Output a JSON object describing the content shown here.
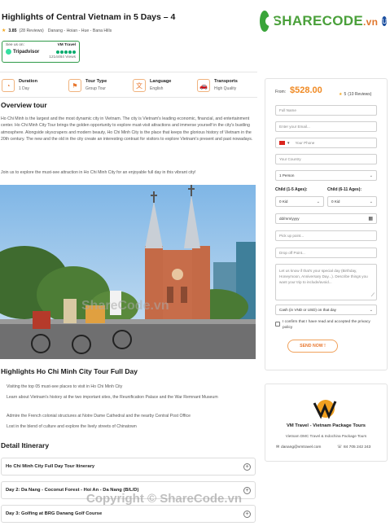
{
  "tour": {
    "title": "Highlights of Central Vietnam in 5 Days – 4",
    "rating_score": "3.85",
    "rating_count": "(28 Reviews)",
    "route": "Danang - Hoian - Hue - Bana Hills"
  },
  "brand": {
    "name": "SHARECODE",
    "suffix": ".vn",
    "badge": "U"
  },
  "tripadvisor": {
    "see_us_on": "See us on:",
    "agency": "VM Travel",
    "logo_text": "Tripadvisor",
    "views": "1214464 Views"
  },
  "facts": [
    {
      "label": "Duration",
      "value": "1 Day",
      "icon": "clock-icon"
    },
    {
      "label": "Tour Type",
      "value": "Group Tour",
      "icon": "flag-icon"
    },
    {
      "label": "Language",
      "value": "English",
      "icon": "translate-icon"
    },
    {
      "label": "Transports",
      "value": "High Quality",
      "icon": "car-icon"
    }
  ],
  "overview": {
    "heading": "Overview tour",
    "p1": "Ho Chi Minh is the largest and the most dynamic city in Vietnam. The city is Vietnam's leading economic, financial, and entertainment center. Ho Chi Minh City Tour brings the golden opportunity to explore must-visit attractions and immerse yourself in the city's bustling atmosphere. Alongside skyscrapers and modern beauty, Ho Chi Minh City is the place that keeps the glorious history of Vietnam in the 20th century. The new and the old in the city create an interesting contrast for visitors to explore Vietnam's present and past nowadays.",
    "p2": "Join us to explore the must-see attraction in Ho Chi Minh City for an enjoyable full day in this vibrant city!"
  },
  "watermark": {
    "image_text": "ShareCode.vn",
    "footer_text": "Copyright © ShareCode.vn"
  },
  "highlights": {
    "heading": "Highlights Ho Chi Minh City Tour Full Day",
    "items": [
      "Visiting the top 05 must-see places to visit in Ho Chi Minh City",
      "Learn about Vietnam's history at the two important sites, the Reunification Palace and the War Remnant Museum",
      "Admire the French colonial structures at Notre Dame Cathedral and the nearby Central Post Office",
      "Lost in the blend of culture and explore the lively streets of Chinatown"
    ]
  },
  "itinerary": {
    "heading": "Detail Itinerary",
    "days": [
      "Ho Chi Minh City Full Day Tour Itinerary",
      "Day 2: Da Nang - Coconut Forest - Hoi An - Da Nang (B/L/D)",
      "Day 3: Golfing at BRG Danang Golf Course"
    ]
  },
  "booking": {
    "from_label": "From:",
    "price": "$528.00",
    "rating": "5",
    "reviews": "(10 Reviews)",
    "full_name": "Full Name",
    "email": "Enter your Email...",
    "phone": "Your Phone",
    "country": "Your Country",
    "persons": "1 Person",
    "child_1_5_label": "Child (1-5 Ages):",
    "child_6_11_label": "Child (6-11 Ages):",
    "child_1_5": "0 Kid",
    "child_6_11": "0 Kid",
    "date": "dd/mm/yyyy",
    "pickup": "Pick up point...",
    "dropoff": "Drop off Point...",
    "message": "Let us know if that's your special day (Birthday, Honeymoon, Anniversary Day...). Describe things you want your trip to include/avoid...",
    "payment": "Cash (in VND or USD) on that day",
    "agree": "I confirm that I have read and accepted the privacy policy",
    "send": "SEND NOW !"
  },
  "company": {
    "name": "VM Travel - Vietnam Package Tours",
    "tagline": "Vietnam DMC Travel & Indochina Package Tours",
    "email": "danang@vmtravel.com",
    "phone": "84 705 242 243"
  },
  "colors": {
    "accent": "#e8772e",
    "price": "#f08a24",
    "ta_green": "#2f9a49"
  }
}
